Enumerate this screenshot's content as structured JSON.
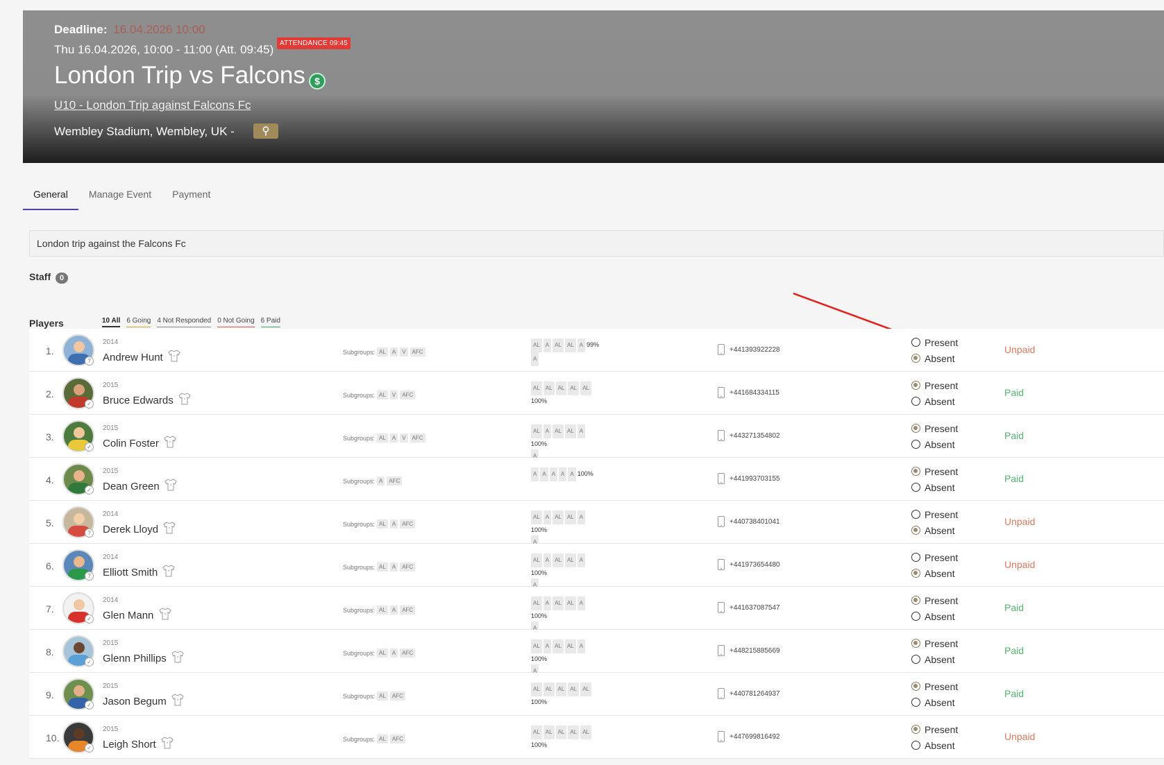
{
  "header": {
    "deadline_label": "Deadline:",
    "deadline_value": "16.04.2026 10:00",
    "datetime": "Thu 16.04.2026, 10:00 - 11:00 (Att. 09:45)",
    "attendance_badge": "ATTENDANCE 09:45",
    "title": "London Trip vs Falcons",
    "payment_icon": "$",
    "team_link": "U10 - London Trip against Falcons Fc",
    "location": "Wembley Stadium, Wembley, UK -",
    "pin_icon": "⚲"
  },
  "tabs": [
    {
      "label": "General",
      "active": true
    },
    {
      "label": "Manage Event",
      "active": false
    },
    {
      "label": "Payment",
      "active": false
    }
  ],
  "description": "London trip against the Falcons Fc",
  "staff": {
    "label": "Staff",
    "count": "0"
  },
  "players_section": {
    "label": "Players",
    "filters": {
      "all": "10 All",
      "going": "6 Going",
      "not_responded": "4 Not Responded",
      "not_going": "0 Not Going",
      "paid": "6 Paid"
    }
  },
  "labels": {
    "subgroups": "Subgroups:",
    "present": "Present",
    "absent": "Absent"
  },
  "colors": {
    "accent": "#4a3ccf",
    "attendance_badge": "#e53935",
    "paid": "#52b36b",
    "unpaid": "#d9795f"
  },
  "players": [
    {
      "num": "1.",
      "year": "2014",
      "name": "Andrew Hunt",
      "subgroups": [
        "AL",
        "A",
        "V",
        "AFC"
      ],
      "attendance": [
        "AL",
        "A",
        "AL",
        "AL",
        "A"
      ],
      "attendance_extra": [
        "A"
      ],
      "pct": "99%",
      "phone": "+441393922228",
      "status": "absent",
      "payment": "Unpaid",
      "skin": "#f2c7a0",
      "shirt": "#3e6fb0",
      "bg": "#8fb3d6"
    },
    {
      "num": "2.",
      "year": "2015",
      "name": "Bruce Edwards",
      "subgroups": [
        "AL",
        "V",
        "AFC"
      ],
      "attendance": [
        "AL",
        "AL",
        "AL",
        "AL",
        "AL"
      ],
      "attendance_extra": [],
      "pct": "100%",
      "phone": "+441684334115",
      "status": "present",
      "payment": "Paid",
      "skin": "#d9a179",
      "shirt": "#c0392b",
      "bg": "#5a6b3a"
    },
    {
      "num": "3.",
      "year": "2015",
      "name": "Colin Foster",
      "subgroups": [
        "AL",
        "A",
        "V",
        "AFC"
      ],
      "attendance": [
        "AL",
        "A",
        "AL",
        "AL",
        "A"
      ],
      "attendance_extra": [
        "A"
      ],
      "pct": "100%",
      "phone": "+443271354802",
      "status": "present",
      "payment": "Paid",
      "skin": "#efc79b",
      "shirt": "#e9c93a",
      "bg": "#4d7a3d"
    },
    {
      "num": "4.",
      "year": "2015",
      "name": "Dean Green",
      "subgroups": [
        "A",
        "AFC"
      ],
      "attendance": [
        "A",
        "A",
        "A",
        "A",
        "A"
      ],
      "attendance_extra": [],
      "pct": "100%",
      "phone": "+441993703155",
      "status": "present",
      "payment": "Paid",
      "skin": "#e8b58a",
      "shirt": "#2f7a3a",
      "bg": "#6c8a4a"
    },
    {
      "num": "5.",
      "year": "2014",
      "name": "Derek Lloyd",
      "subgroups": [
        "AL",
        "A",
        "AFC"
      ],
      "attendance": [
        "AL",
        "A",
        "AL",
        "AL",
        "A"
      ],
      "attendance_extra": [
        "A"
      ],
      "pct": "100%",
      "phone": "+440738401041",
      "status": "absent",
      "payment": "Unpaid",
      "skin": "#f3cfa8",
      "shirt": "#d64b3f",
      "bg": "#c7b79c"
    },
    {
      "num": "6.",
      "year": "2014",
      "name": "Elliott Smith",
      "subgroups": [
        "AL",
        "A",
        "AFC"
      ],
      "attendance": [
        "AL",
        "A",
        "AL",
        "AL",
        "A"
      ],
      "attendance_extra": [
        "A"
      ],
      "pct": "100%",
      "phone": "+441973654480",
      "status": "absent",
      "payment": "Unpaid",
      "skin": "#e9b88c",
      "shirt": "#2a9a4a",
      "bg": "#5b88b8"
    },
    {
      "num": "7.",
      "year": "2014",
      "name": "Glen Mann",
      "subgroups": [
        "AL",
        "A",
        "AFC"
      ],
      "attendance": [
        "AL",
        "A",
        "AL",
        "AL",
        "A"
      ],
      "attendance_extra": [
        "A"
      ],
      "pct": "100%",
      "phone": "+441637087547",
      "status": "present",
      "payment": "Paid",
      "skin": "#f0c8a3",
      "shirt": "#d8312b",
      "bg": "#f2f2f2"
    },
    {
      "num": "8.",
      "year": "2015",
      "name": "Glenn Phillips",
      "subgroups": [
        "AL",
        "A",
        "AFC"
      ],
      "attendance": [
        "AL",
        "A",
        "AL",
        "AL",
        "A"
      ],
      "attendance_extra": [
        "A"
      ],
      "pct": "100%",
      "phone": "+448215885669",
      "status": "present",
      "payment": "Paid",
      "skin": "#6b4630",
      "shirt": "#5aa0d8",
      "bg": "#a8c4d8"
    },
    {
      "num": "9.",
      "year": "2015",
      "name": "Jason Begum",
      "subgroups": [
        "AL",
        "AFC"
      ],
      "attendance": [
        "AL",
        "AL",
        "AL",
        "AL",
        "AL"
      ],
      "attendance_extra": [],
      "pct": "100%",
      "phone": "+440781264937",
      "status": "present",
      "payment": "Paid",
      "skin": "#e3b088",
      "shirt": "#3563a8",
      "bg": "#6e8f4e"
    },
    {
      "num": "10.",
      "year": "2015",
      "name": "Leigh Short",
      "subgroups": [
        "AL",
        "AFC"
      ],
      "attendance": [
        "AL",
        "AL",
        "AL",
        "AL",
        "AL"
      ],
      "attendance_extra": [],
      "pct": "100%",
      "phone": "+447699816492",
      "status": "present",
      "payment": "Unpaid",
      "skin": "#5e3b26",
      "shirt": "#e8862a",
      "bg": "#3a3a3a"
    }
  ]
}
